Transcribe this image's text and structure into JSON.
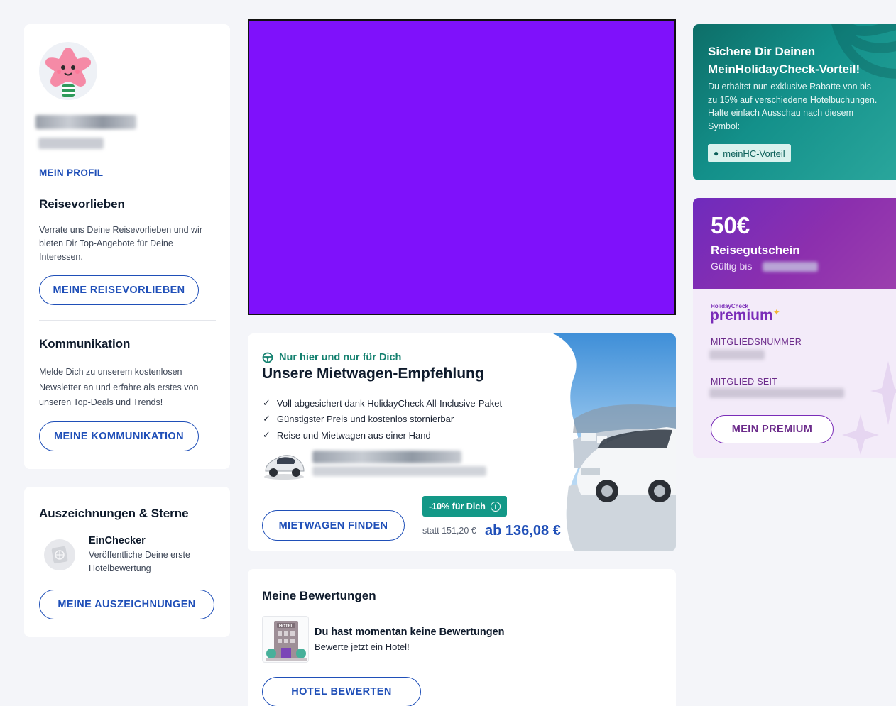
{
  "profile": {
    "link_label": "MEIN PROFIL",
    "travel_prefs": {
      "title": "Reisevorlieben",
      "text": "Verrate uns Deine Reisevorlieben und wir bieten Dir Top-Angebote für Deine Interessen.",
      "button": "MEINE REISEVORLIEBEN"
    },
    "communication": {
      "title": "Kommunikation",
      "text": "Melde Dich zu unserem kostenlosen Newsletter an und erfahre als erstes von unseren Top-Deals und Trends!",
      "button": "MEINE KOMMUNIKATION"
    }
  },
  "awards": {
    "title": "Auszeichnungen & Sterne",
    "badge_name": "EinChecker",
    "badge_desc": "Veröffentliche Deine erste Hotelbewertung",
    "button": "MEINE AUSZEICHNUNGEN"
  },
  "rental": {
    "tagline": "Nur hier und nur für Dich",
    "title": "Unsere Mietwagen-Empfehlung",
    "bullets": [
      "Voll abgesichert dank HolidayCheck All-Inclusive-Paket",
      "Günstigster Preis und kostenlos stornierbar",
      "Reise und Mietwagen aus einer Hand"
    ],
    "button": "MIETWAGEN FINDEN",
    "discount_badge": "-10% für Dich",
    "old_price": "statt 151,20 €",
    "new_price": "ab 136,08 €"
  },
  "reviews": {
    "title": "Meine Bewertungen",
    "empty_title": "Du hast momentan keine Bewertungen",
    "empty_sub": "Bewerte jetzt ein Hotel!",
    "hotel_sign": "HOTEL",
    "button": "HOTEL BEWERTEN"
  },
  "vorteil": {
    "title": "Sichere Dir Deinen MeinHolidayCheck-Vorteil!",
    "text": "Du erhältst nun exklusive Rabatte von bis zu 15% auf verschiedene Hotelbuchungen. Halte einfach Ausschau nach diesem Symbol:",
    "chip": "meinHC-Vorteil"
  },
  "premium": {
    "amount": "50€",
    "voucher": "Reisegutschein",
    "valid_prefix": "Gültig bis",
    "logo_small": "HolidayCheck",
    "logo_big": "premium",
    "member_no_label": "MITGLIEDSNUMMER",
    "member_since_label": "MITGLIED SEIT",
    "button": "MEIN PREMIUM"
  },
  "colors": {
    "accent_blue": "#1f4fb8",
    "teal": "#13908a",
    "purple": "#7a2cb8",
    "ad_purple": "#7f11fb"
  }
}
